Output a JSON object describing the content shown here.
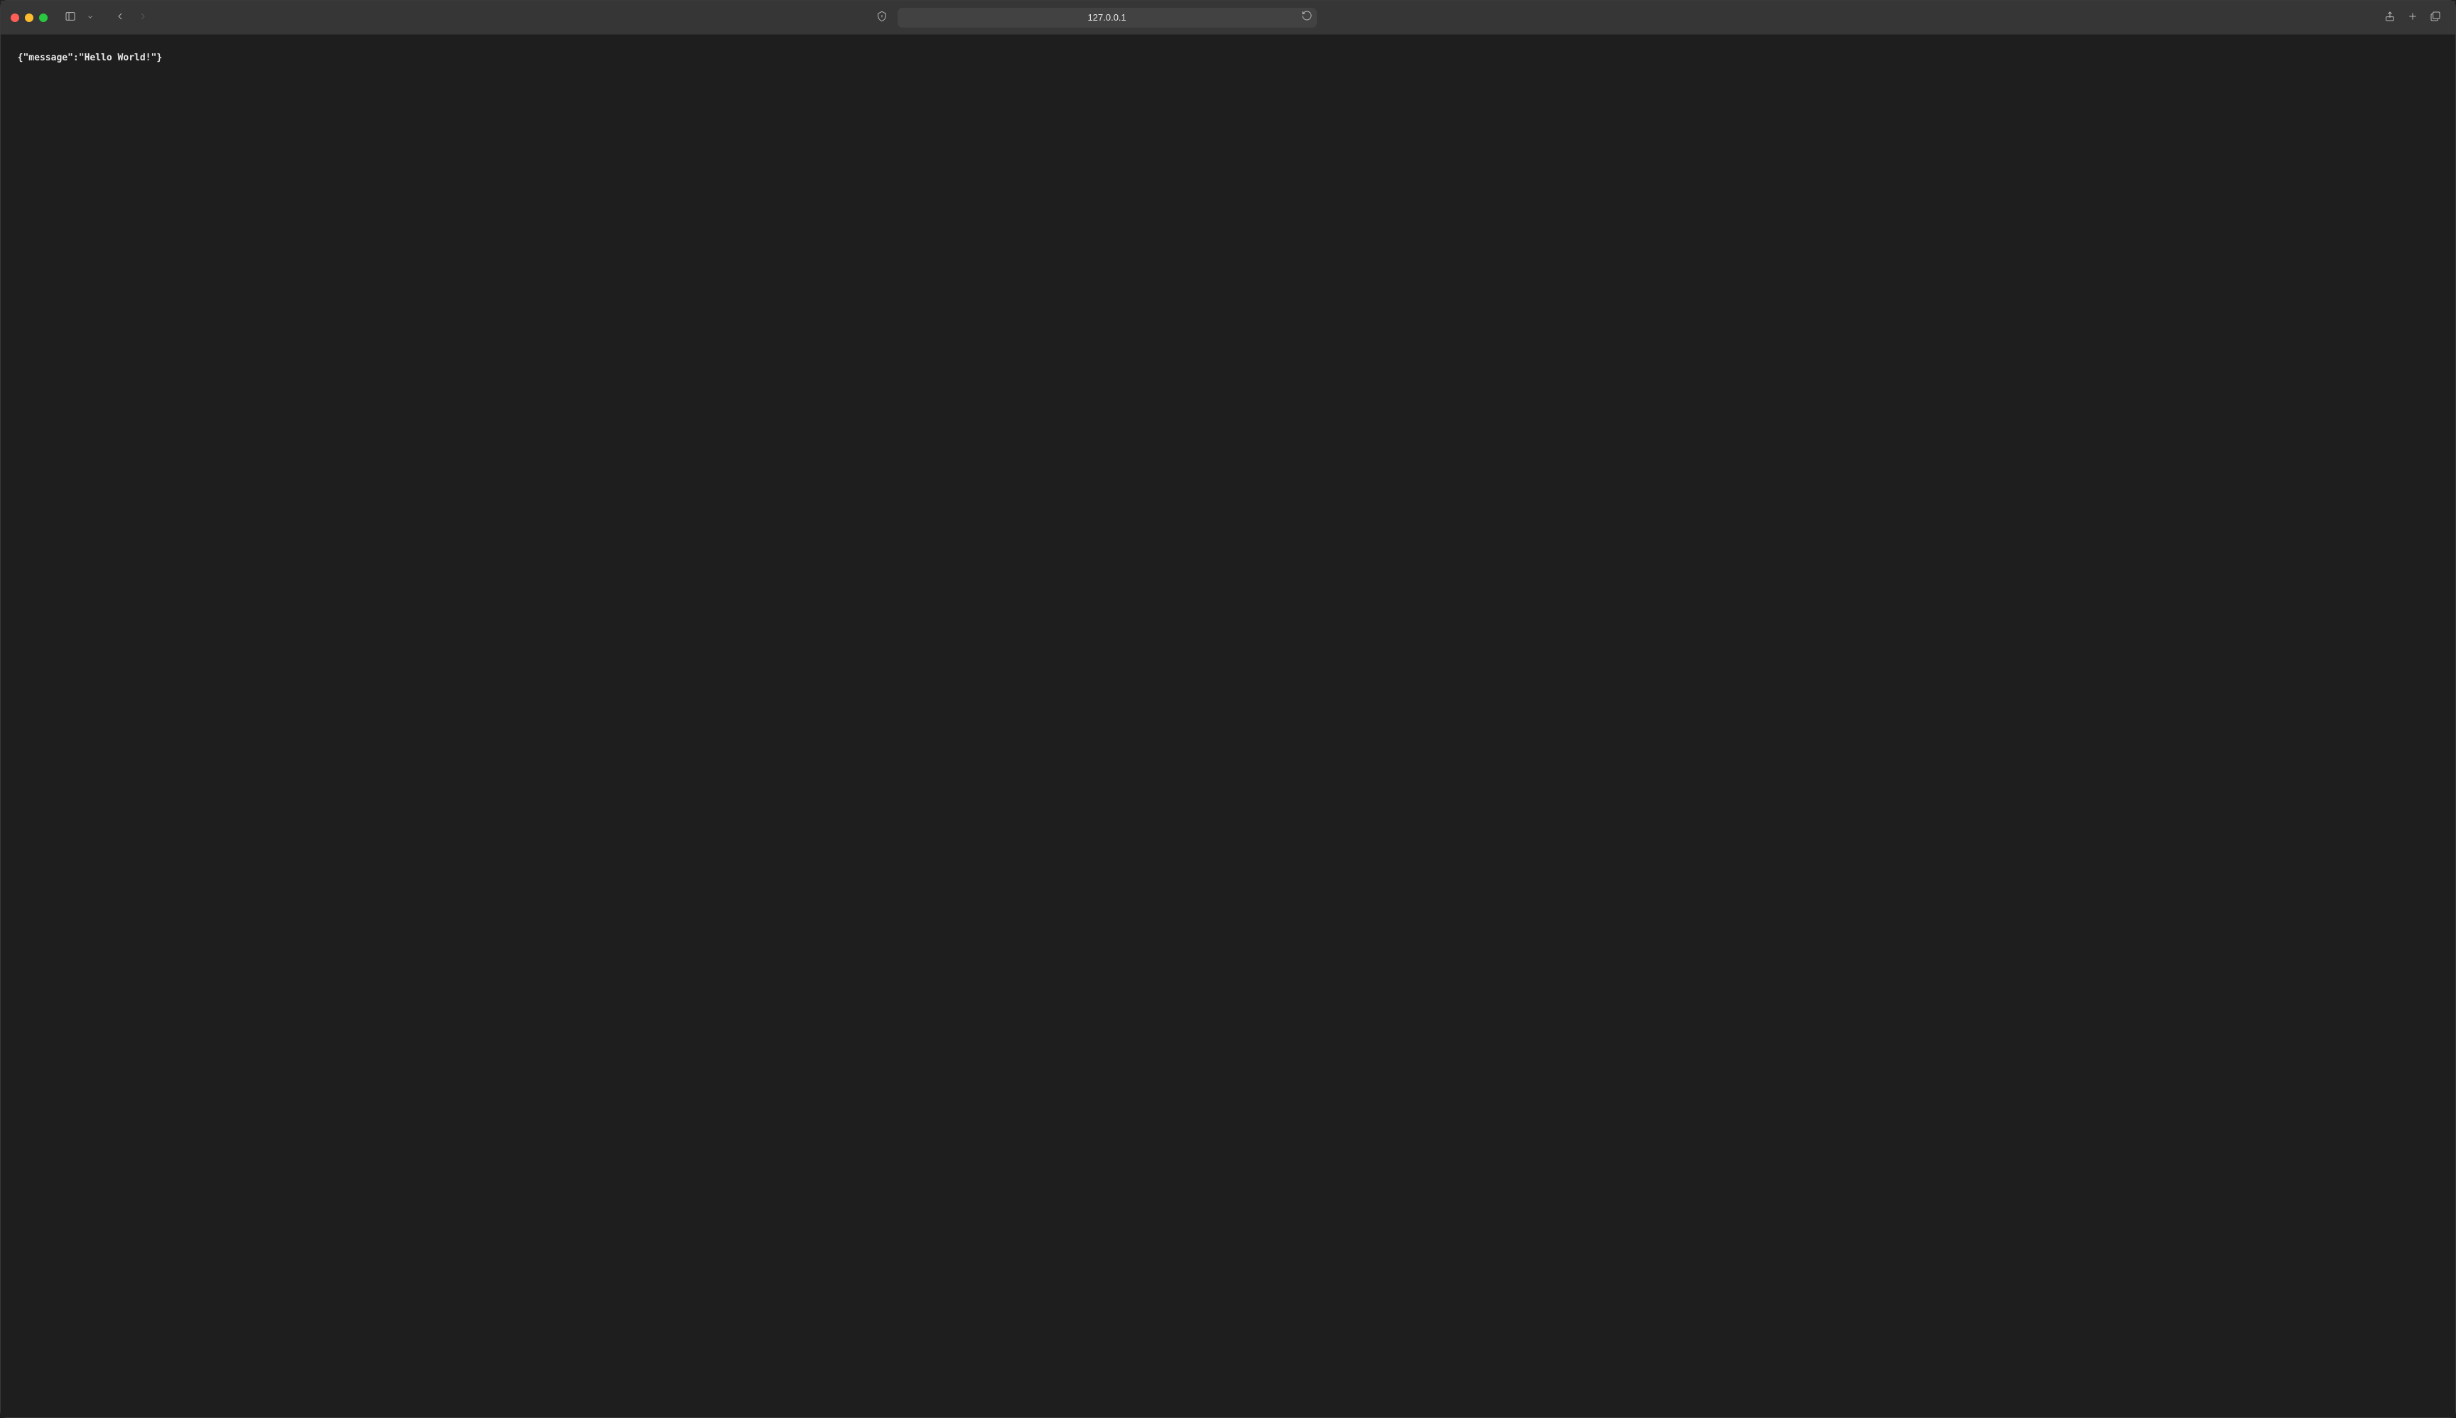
{
  "browser": {
    "address": "127.0.0.1"
  },
  "page": {
    "body": "{\"message\":\"Hello World!\"}"
  }
}
